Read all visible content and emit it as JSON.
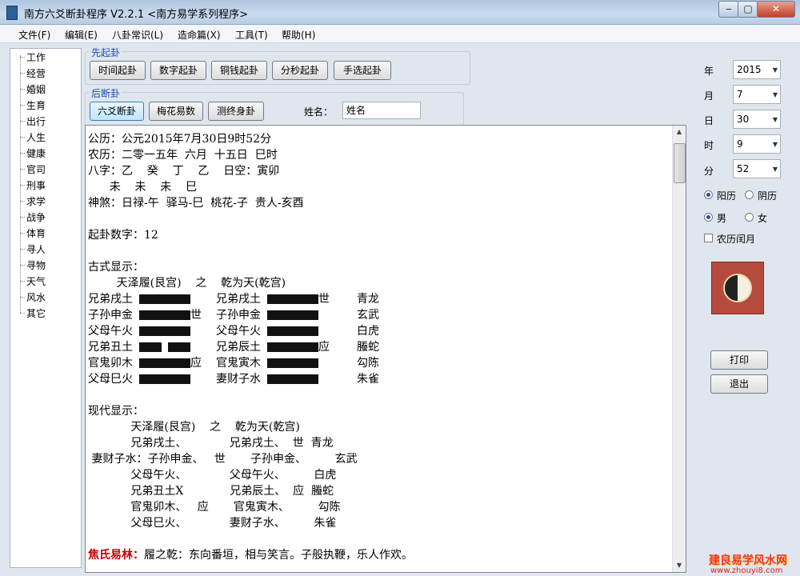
{
  "window": {
    "title": "南方六爻断卦程序 V2.2.1    <南方易学系列程序>"
  },
  "menu": [
    "文件(F)",
    "编辑(E)",
    "八卦常识(L)",
    "造命篇(X)",
    "工具(T)",
    "帮助(H)"
  ],
  "tree": [
    "工作",
    "经营",
    "婚姻",
    "生育",
    "出行",
    "人生",
    "健康",
    "官司",
    "刑事",
    "求学",
    "战争",
    "体育",
    "寻人",
    "寻物",
    "天气",
    "风水",
    "其它"
  ],
  "xianqigua": {
    "title": "先起卦",
    "buttons": [
      "时间起卦",
      "数字起卦",
      "铜钱起卦",
      "分秒起卦",
      "手选起卦"
    ]
  },
  "houduangua": {
    "title": "后断卦",
    "buttons": [
      "六爻断卦",
      "梅花易数",
      "测终身卦"
    ],
    "name_label": "姓名：",
    "name_value": "姓名"
  },
  "date": {
    "year_label": "年",
    "year": "2015",
    "month_label": "月",
    "month": "7",
    "day_label": "日",
    "day": "30",
    "hour_label": "时",
    "hour": "9",
    "minute_label": "分",
    "minute": "52"
  },
  "options": {
    "yangli": "阳历",
    "yinli": "阴历",
    "male": "男",
    "female": "女",
    "leap": "农历闰月",
    "selected_calendar": "阳历",
    "selected_gender": "男"
  },
  "actions": {
    "print": "打印",
    "exit": "退出"
  },
  "content": {
    "l1": "公历：公元2015年7月30日9时52分",
    "l2": "农历：二零一五年  六月  十五日  巳时",
    "l3": "八字：乙    癸    丁    乙    日空：寅卯",
    "l4": "      未    未    未    巳",
    "l5": "神煞：日禄-午  驿马-巳  桃花-子  贵人-亥酉",
    "l6": "起卦数字：12",
    "l7": "古式显示：",
    "l8": "        天泽履(艮宫)    之    乾为天(乾宫)",
    "gu": [
      {
        "left": "兄弟戌土",
        "lbroken": false,
        "lmark": "",
        "right": "兄弟戌土",
        "rbroken": false,
        "rmark": "世",
        "god": "青龙"
      },
      {
        "left": "子孙申金",
        "lbroken": false,
        "lmark": "世",
        "right": "子孙申金",
        "rbroken": false,
        "rmark": "",
        "god": "玄武"
      },
      {
        "left": "父母午火",
        "lbroken": false,
        "lmark": "",
        "right": "父母午火",
        "rbroken": false,
        "rmark": "",
        "god": "白虎"
      },
      {
        "left": "兄弟丑土",
        "lbroken": true,
        "lmark": "",
        "right": "兄弟辰土",
        "rbroken": false,
        "rmark": "应",
        "god": "螣蛇"
      },
      {
        "left": "官鬼卯木",
        "lbroken": false,
        "lmark": "应",
        "right": "官鬼寅木",
        "rbroken": false,
        "rmark": "",
        "god": "勾陈"
      },
      {
        "left": "父母巳火",
        "lbroken": false,
        "lmark": "",
        "right": "妻财子水",
        "rbroken": false,
        "rmark": "",
        "god": "朱雀"
      }
    ],
    "l9": "现代显示：",
    "l10": "            天泽履(艮宫)    之    乾为天(乾宫)",
    "xd": [
      "            兄弟戌土、            兄弟戌土、  世  青龙",
      " 妻财子水：子孙申金、   世       子孙申金、        玄武",
      "            父母午火、            父母午火、        白虎",
      "            兄弟丑土X             兄弟辰土、  应  螣蛇",
      "            官鬼卯木、   应       官鬼寅木、        勾陈",
      "            父母巳火、            妻财子水、        朱雀"
    ],
    "jiao_label": "焦氏易林：",
    "jiao_text": "履之乾：东向番垣，相与笑言。子般执鞭，乐人作欢。"
  },
  "watermark": {
    "text": "建良易学风水网",
    "url": "www.zhouyi8.com"
  }
}
